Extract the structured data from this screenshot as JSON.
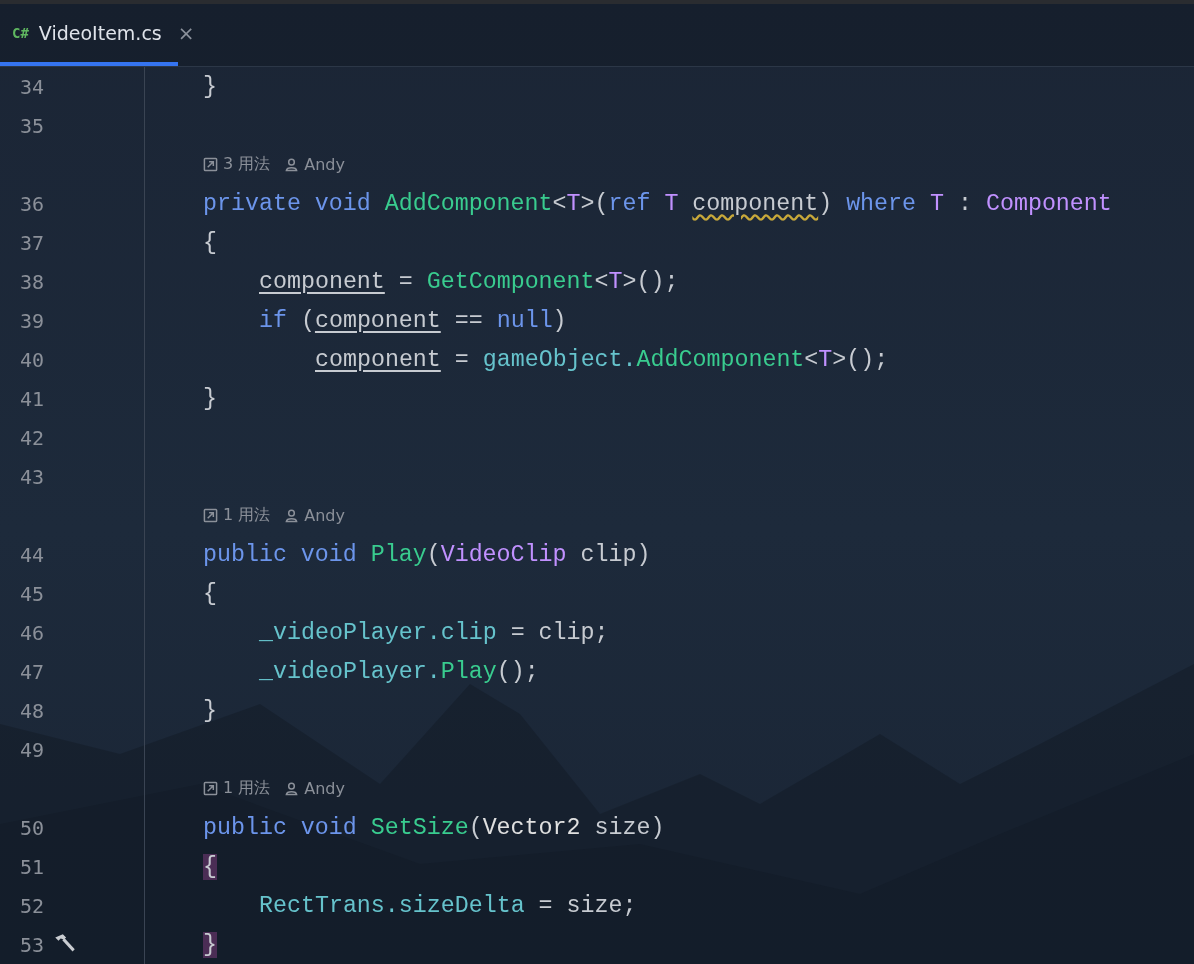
{
  "tab": {
    "lang_badge": "C#",
    "title": "VideoItem.cs",
    "close": "×",
    "selected": true
  },
  "rows": [
    {
      "kind": "code",
      "number": "34",
      "tokens": [
        {
          "text": "}",
          "kind": "plain"
        }
      ]
    },
    {
      "kind": "code",
      "number": "35"
    },
    {
      "kind": "hint",
      "usages": "3 用法",
      "author": "Andy"
    },
    {
      "kind": "code",
      "number": "36",
      "tokens": [
        {
          "text": "private void ",
          "kind": "kw"
        },
        {
          "text": "AddComponent",
          "kind": "fn"
        },
        {
          "text": "<",
          "kind": "plain"
        },
        {
          "text": "T",
          "kind": "type"
        },
        {
          "text": ">(",
          "kind": "plain"
        },
        {
          "text": "ref ",
          "kind": "kw"
        },
        {
          "text": "T ",
          "kind": "type"
        },
        {
          "text": "component",
          "kind": "warn"
        },
        {
          "text": ") ",
          "kind": "plain"
        },
        {
          "text": "where ",
          "kind": "kw"
        },
        {
          "text": "T",
          "kind": "type"
        },
        {
          "text": " : ",
          "kind": "plain"
        },
        {
          "text": "Component",
          "kind": "type"
        }
      ]
    },
    {
      "kind": "code",
      "number": "37",
      "tokens": [
        {
          "text": "{",
          "kind": "plain"
        }
      ],
      "children": [
        {
          "kind": "code",
          "number": "38",
          "tokens": [
            {
              "text": "component",
              "kind": "local"
            },
            {
              "text": " = ",
              "kind": "plain"
            },
            {
              "text": "GetComponent",
              "kind": "fn"
            },
            {
              "text": "<",
              "kind": "plain"
            },
            {
              "text": "T",
              "kind": "type"
            },
            {
              "text": ">();",
              "kind": "plain"
            }
          ]
        },
        {
          "kind": "code",
          "number": "39",
          "tokens": [
            {
              "text": "if ",
              "kind": "kw"
            },
            {
              "text": "(",
              "kind": "plain"
            },
            {
              "text": "component",
              "kind": "local"
            },
            {
              "text": " == ",
              "kind": "plain"
            },
            {
              "text": "null",
              "kind": "kw"
            },
            {
              "text": ")",
              "kind": "plain"
            }
          ],
          "children": [
            {
              "kind": "code",
              "number": "40",
              "tokens": [
                {
                  "text": "component",
                  "kind": "local"
                },
                {
                  "text": " = ",
                  "kind": "plain"
                },
                {
                  "text": "gameObject.",
                  "kind": "field"
                },
                {
                  "text": "AddComponent",
                  "kind": "fn"
                },
                {
                  "text": "<",
                  "kind": "plain"
                },
                {
                  "text": "T",
                  "kind": "type"
                },
                {
                  "text": ">();",
                  "kind": "plain"
                }
              ]
            }
          ]
        }
      ]
    },
    {
      "kind": "code",
      "number": "41",
      "tokens": [
        {
          "text": "}",
          "kind": "plain"
        }
      ]
    },
    {
      "kind": "code",
      "number": "42"
    },
    {
      "kind": "code",
      "number": "43"
    },
    {
      "kind": "hint",
      "usages": "1 用法",
      "author": "Andy"
    },
    {
      "kind": "code",
      "number": "44",
      "tokens": [
        {
          "text": "public void ",
          "kind": "kw"
        },
        {
          "text": "Play",
          "kind": "fn"
        },
        {
          "text": "(",
          "kind": "plain"
        },
        {
          "text": "VideoClip",
          "kind": "type"
        },
        {
          "text": " clip)",
          "kind": "plain"
        }
      ]
    },
    {
      "kind": "code",
      "number": "45",
      "tokens": [
        {
          "text": "{",
          "kind": "plain"
        }
      ],
      "children": [
        {
          "kind": "code",
          "number": "46",
          "tokens": [
            {
              "text": "_videoPlayer.clip",
              "kind": "field"
            },
            {
              "text": " = clip;",
              "kind": "plain"
            }
          ]
        },
        {
          "kind": "code",
          "number": "47",
          "tokens": [
            {
              "text": "_videoPlayer.",
              "kind": "field"
            },
            {
              "text": "Play",
              "kind": "fn"
            },
            {
              "text": "();",
              "kind": "plain"
            }
          ]
        }
      ]
    },
    {
      "kind": "code",
      "number": "48",
      "tokens": [
        {
          "text": "}",
          "kind": "plain"
        }
      ]
    },
    {
      "kind": "code",
      "number": "49"
    },
    {
      "kind": "hint",
      "usages": "1 用法",
      "author": "Andy"
    },
    {
      "kind": "code",
      "number": "50",
      "tokens": [
        {
          "text": "public void ",
          "kind": "kw"
        },
        {
          "text": "SetSize",
          "kind": "fn"
        },
        {
          "text": "(",
          "kind": "plain"
        },
        {
          "text": "Vector2",
          "kind": "struct"
        },
        {
          "text": " size)",
          "kind": "plain"
        }
      ]
    },
    {
      "kind": "code",
      "number": "51",
      "tokens": [
        {
          "text": "{",
          "kind": "match"
        }
      ],
      "children": [
        {
          "kind": "code",
          "number": "52",
          "tokens": [
            {
              "text": "RectTrans.sizeDelta",
              "kind": "field"
            },
            {
              "text": " = size;",
              "kind": "plain"
            }
          ]
        }
      ]
    },
    {
      "kind": "code",
      "number": "53",
      "build_marker": true,
      "tokens": [
        {
          "text": "}",
          "kind": "match"
        }
      ]
    }
  ]
}
